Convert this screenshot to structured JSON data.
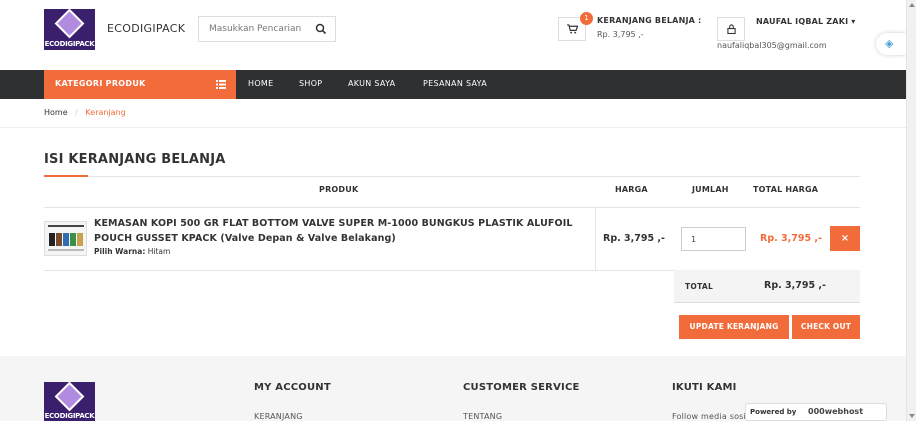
{
  "header": {
    "brand": "ECODIGIPACK",
    "logo_text": "ECODIGIPACK",
    "search_placeholder": "Masukkan Pencarian ...",
    "cart_count": "1",
    "cart_label": "KERANJANG BELANJA :",
    "cart_total": "Rp. 3,795 ,-",
    "user_name": "NAUFAL IQBAL ZAKI ▾",
    "user_email": "naufaliqbal305@gmail.com"
  },
  "nav": {
    "category_label": "KATEGORI PRODUK",
    "items": [
      "HOME",
      "SHOP",
      "AKUN SAYA",
      "PESANAN SAYA"
    ]
  },
  "breadcrumb": {
    "home": "Home",
    "separator": "/",
    "current": "Keranjang"
  },
  "cart": {
    "title": "ISI KERANJANG BELANJA",
    "columns": {
      "product": "PRODUK",
      "price": "HARGA",
      "qty": "JUMLAH",
      "total": "TOTAL HARGA"
    },
    "items": [
      {
        "name": "KEMASAN KOPI 500 GR FLAT BOTTOM VALVE SUPER M-1000 BUNGKUS PLASTIK ALUFOIL POUCH GUSSET KPACK (Valve Depan & Valve Belakang)",
        "option_label": "Pilih Warna:",
        "option_value": "Hitam",
        "price": "Rp. 3,795 ,-",
        "qty": "1",
        "line_total": "Rp. 3,795 ,-",
        "remove_label": "×"
      }
    ],
    "total_label": "TOTAL",
    "total_value": "Rp. 3,795 ,-",
    "update_label": "UPDATE KERANJANG",
    "checkout_label": "CHECK OUT"
  },
  "footer": {
    "logo_text": "ECODIGIPACK",
    "headings": [
      "MY ACCOUNT",
      "CUSTOMER SERVICE",
      "IKUTI KAMI"
    ],
    "links": [
      "KERANJANG",
      "TENTANG",
      "Follow media sosial kami untuk info terbaru"
    ]
  },
  "badge": {
    "powered": "Powered by",
    "host": "000webhost"
  },
  "colors": {
    "accent": "#f26b3a",
    "nav_bg": "#2e3032",
    "logo_bg": "#3a1f6d"
  }
}
